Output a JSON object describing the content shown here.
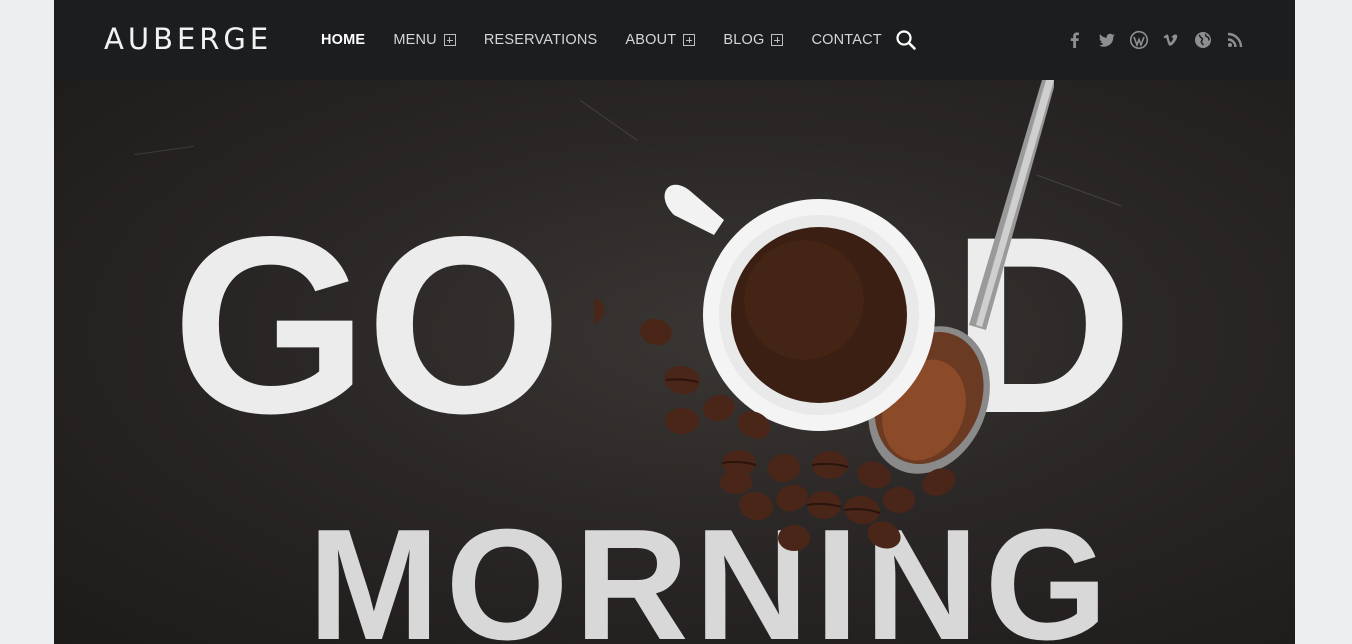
{
  "brand": {
    "name": "AUBERGE"
  },
  "nav": {
    "items": [
      {
        "label": "HOME",
        "active": true,
        "submenu": false
      },
      {
        "label": "MENU",
        "active": false,
        "submenu": true
      },
      {
        "label": "RESERVATIONS",
        "active": false,
        "submenu": false
      },
      {
        "label": "ABOUT",
        "active": false,
        "submenu": true
      },
      {
        "label": "BLOG",
        "active": false,
        "submenu": true
      },
      {
        "label": "CONTACT",
        "active": false,
        "submenu": false
      }
    ],
    "search_icon": "search-icon"
  },
  "social": [
    "facebook-icon",
    "twitter-icon",
    "wordpress-icon",
    "vimeo-icon",
    "globe-icon",
    "rss-icon"
  ],
  "hero": {
    "line1_left": "GO",
    "line1_right": "D",
    "line2": "MORNING"
  },
  "colors": {
    "header_bg": "#1c1d1f",
    "page_bg": "#eceef0",
    "hero_bg": "#2a2726",
    "text": "#ececec",
    "coffee": "#3b1f12"
  }
}
